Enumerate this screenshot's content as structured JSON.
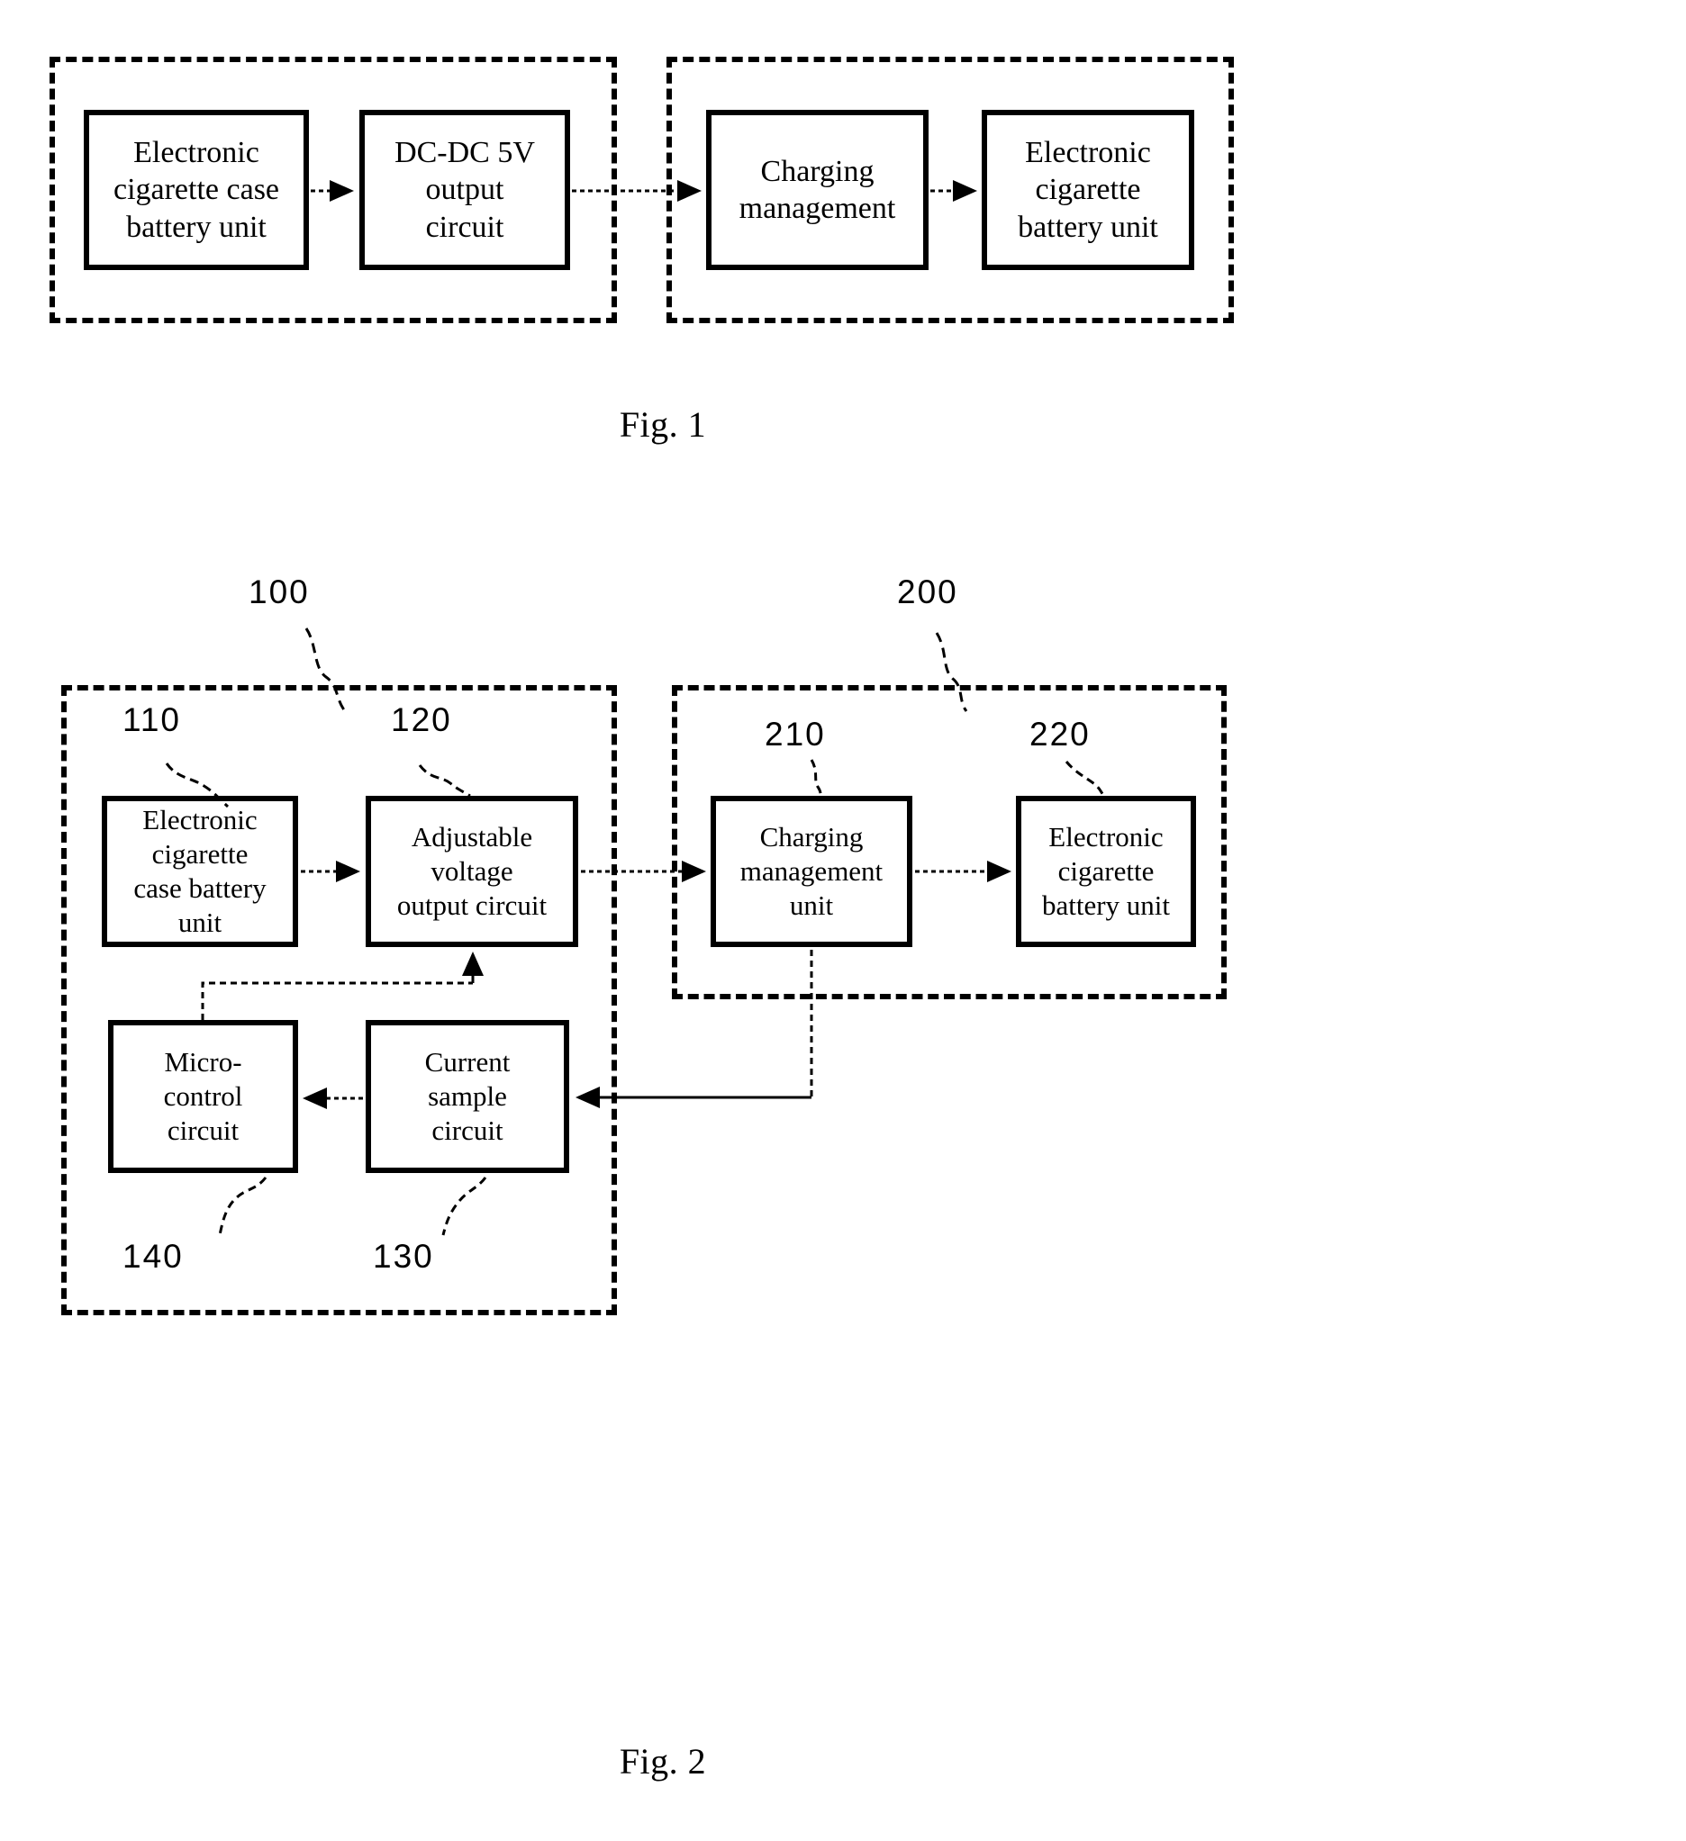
{
  "document": {
    "type": "patent-figure-sheet",
    "background_color": "#ffffff",
    "line_color": "#000000"
  },
  "figures": [
    {
      "id": "fig1",
      "caption": "Fig. 1",
      "groups": [
        {
          "id": "fig1-group-left",
          "style": "dashed"
        },
        {
          "id": "fig1-group-right",
          "style": "dashed"
        }
      ],
      "boxes": [
        {
          "id": "fig1-box-1",
          "label": "Electronic\ncigarette case\nbattery unit"
        },
        {
          "id": "fig1-box-2",
          "label": "DC-DC 5V\noutput\ncircuit"
        },
        {
          "id": "fig1-box-3",
          "label": "Charging\nmanagement"
        },
        {
          "id": "fig1-box-4",
          "label": "Electronic\ncigarette\nbattery unit"
        }
      ],
      "connections": [
        {
          "from": "fig1-box-1",
          "to": "fig1-box-2",
          "style": "dashed-arrow"
        },
        {
          "from": "fig1-box-2",
          "to": "fig1-box-3",
          "style": "dashed-arrow"
        },
        {
          "from": "fig1-box-3",
          "to": "fig1-box-4",
          "style": "dashed-arrow"
        }
      ]
    },
    {
      "id": "fig2",
      "caption": "Fig. 2",
      "groups": [
        {
          "id": "fig2-group-left",
          "style": "dashed",
          "ref": "100"
        },
        {
          "id": "fig2-group-right",
          "style": "dashed",
          "ref": "200"
        }
      ],
      "boxes": [
        {
          "id": "fig2-box-110",
          "ref": "110",
          "label": "Electronic\ncigarette\ncase battery\nunit"
        },
        {
          "id": "fig2-box-120",
          "ref": "120",
          "label": "Adjustable\nvoltage\noutput circuit"
        },
        {
          "id": "fig2-box-140",
          "ref": "140",
          "label": "Micro-\ncontrol\ncircuit"
        },
        {
          "id": "fig2-box-130",
          "ref": "130",
          "label": "Current\nsample\ncircuit"
        },
        {
          "id": "fig2-box-210",
          "ref": "210",
          "label": "Charging\nmanagement\nunit"
        },
        {
          "id": "fig2-box-220",
          "ref": "220",
          "label": "Electronic\ncigarette\nbattery unit"
        }
      ],
      "connections": [
        {
          "from": "fig2-box-110",
          "to": "fig2-box-120",
          "style": "dashed-arrow"
        },
        {
          "from": "fig2-box-120",
          "to": "fig2-box-210",
          "style": "dashed-arrow"
        },
        {
          "from": "fig2-box-210",
          "to": "fig2-box-220",
          "style": "dashed-arrow"
        },
        {
          "from": "fig2-box-130",
          "to": "fig2-box-140",
          "style": "dashed-arrow"
        },
        {
          "from": "fig2-box-140",
          "to": "fig2-box-120",
          "style": "dashed-arrow-feedback"
        },
        {
          "from": "fig2-box-210",
          "to": "fig2-box-130",
          "style": "solid-arrow-feedback"
        }
      ]
    }
  ],
  "reference_numerals": {
    "r100": "100",
    "r110": "110",
    "r120": "120",
    "r130": "130",
    "r140": "140",
    "r200": "200",
    "r210": "210",
    "r220": "220"
  },
  "captions": {
    "fig1": "Fig. 1",
    "fig2": "Fig. 2"
  },
  "fig1": {
    "box1": "Electronic\ncigarette case\nbattery unit",
    "box2": "DC-DC 5V\noutput\ncircuit",
    "box3": "Charging\nmanagement",
    "box4": "Electronic\ncigarette\nbattery unit"
  },
  "fig2": {
    "box110": "Electronic\ncigarette\ncase battery\nunit",
    "box120": "Adjustable\nvoltage\noutput circuit",
    "box140": "Micro-\ncontrol\ncircuit",
    "box130": "Current\nsample\ncircuit",
    "box210": "Charging\nmanagement\nunit",
    "box220": "Electronic\ncigarette\nbattery unit"
  }
}
